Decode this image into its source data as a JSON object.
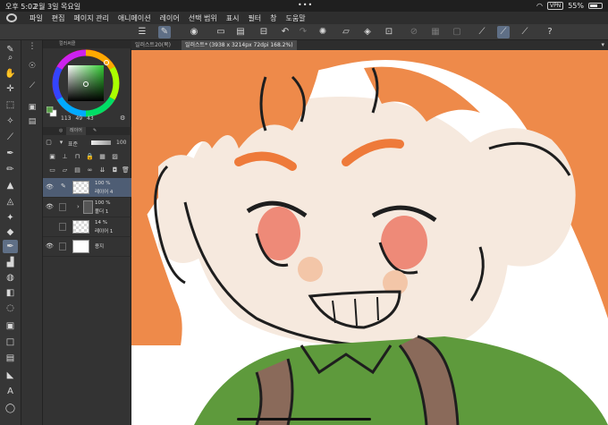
{
  "status_bar": {
    "time": "오후 5:02",
    "date": "2월 3일 목요일",
    "dots": "•••",
    "vpn": "VPN",
    "battery": "55%",
    "battery_level": 0.55
  },
  "menu": [
    "파일",
    "편집",
    "페이지 관리",
    "애니메이션",
    "레이어",
    "선택 범위",
    "표시",
    "필터",
    "창",
    "도움말"
  ],
  "color_panel": {
    "tab_label": "컬러써클",
    "values": [
      "113",
      "49",
      "43"
    ],
    "main_color": "#5aa04a",
    "sub_color": "#ffffff"
  },
  "layer_panel": {
    "tab_label": "레이어",
    "blend_mode": "표준",
    "opacity": "100",
    "layers": [
      {
        "opacity": "100 %",
        "name": "레이어 4",
        "selected": true
      },
      {
        "opacity": "100 %",
        "name": "폴더 1",
        "selected": false
      },
      {
        "opacity": "14 %",
        "name": "레이어 1",
        "selected": false
      },
      {
        "opacity": "",
        "name": "용지",
        "selected": false
      }
    ]
  },
  "document_tabs": {
    "tab1": "일러스트20(복)",
    "tab2": "일러스트* (3938 x 3214px 72dpi 168.2%)"
  },
  "colors": {
    "hair": "#ee8a4a",
    "skin": "#f6e9de",
    "cheek": "#ee8a78",
    "shirt": "#5e9a3c",
    "strap": "#8a6a5a",
    "line": "#1e1e1e",
    "accent": "#5f6f86"
  }
}
